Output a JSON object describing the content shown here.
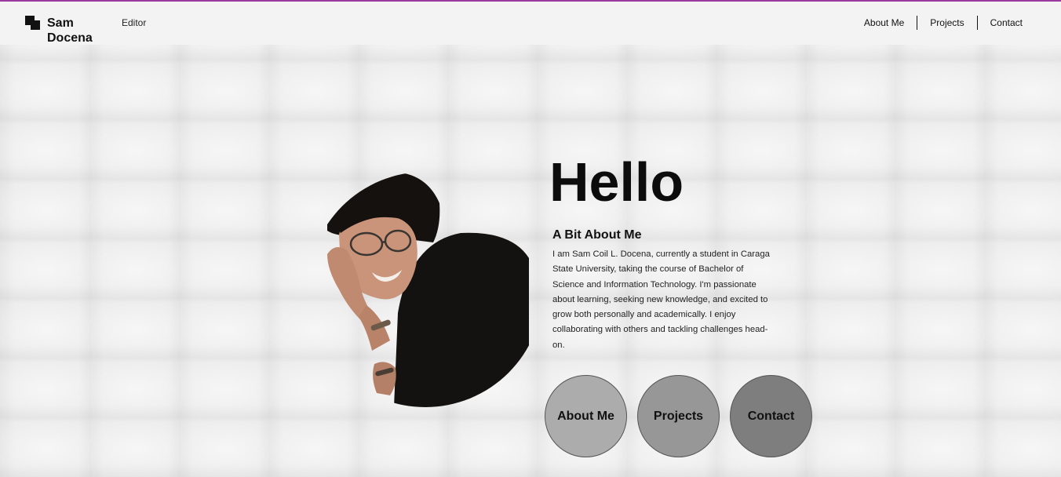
{
  "brand": {
    "line1": "Sam",
    "line2": "Docena",
    "logo_icon": "stacked-squares-icon"
  },
  "editor_label": "Editor",
  "top_nav": [
    {
      "label": "About Me"
    },
    {
      "label": "Projects"
    },
    {
      "label": "Contact"
    }
  ],
  "hero": {
    "title": "Hello",
    "about_heading": "A Bit About Me",
    "about_text": "I am Sam Coil L. Docena, currently a student in Caraga State University, taking the course of Bachelor of Science and Information Technology. I'm passionate about learning, seeking new knowledge, and excited to grow both personally and academically. I enjoy collaborating with others and tackling challenges head-on.",
    "photo_desc": "portrait-photo"
  },
  "circle_buttons": [
    {
      "label": "About Me",
      "color": "#acacac"
    },
    {
      "label": "Projects",
      "color": "#979797"
    },
    {
      "label": "Contact",
      "color": "#7e7e7e"
    }
  ],
  "colors": {
    "accent": "#9b3a9e",
    "header_bg": "#f3f3f3",
    "page_bg": "#ececec"
  }
}
